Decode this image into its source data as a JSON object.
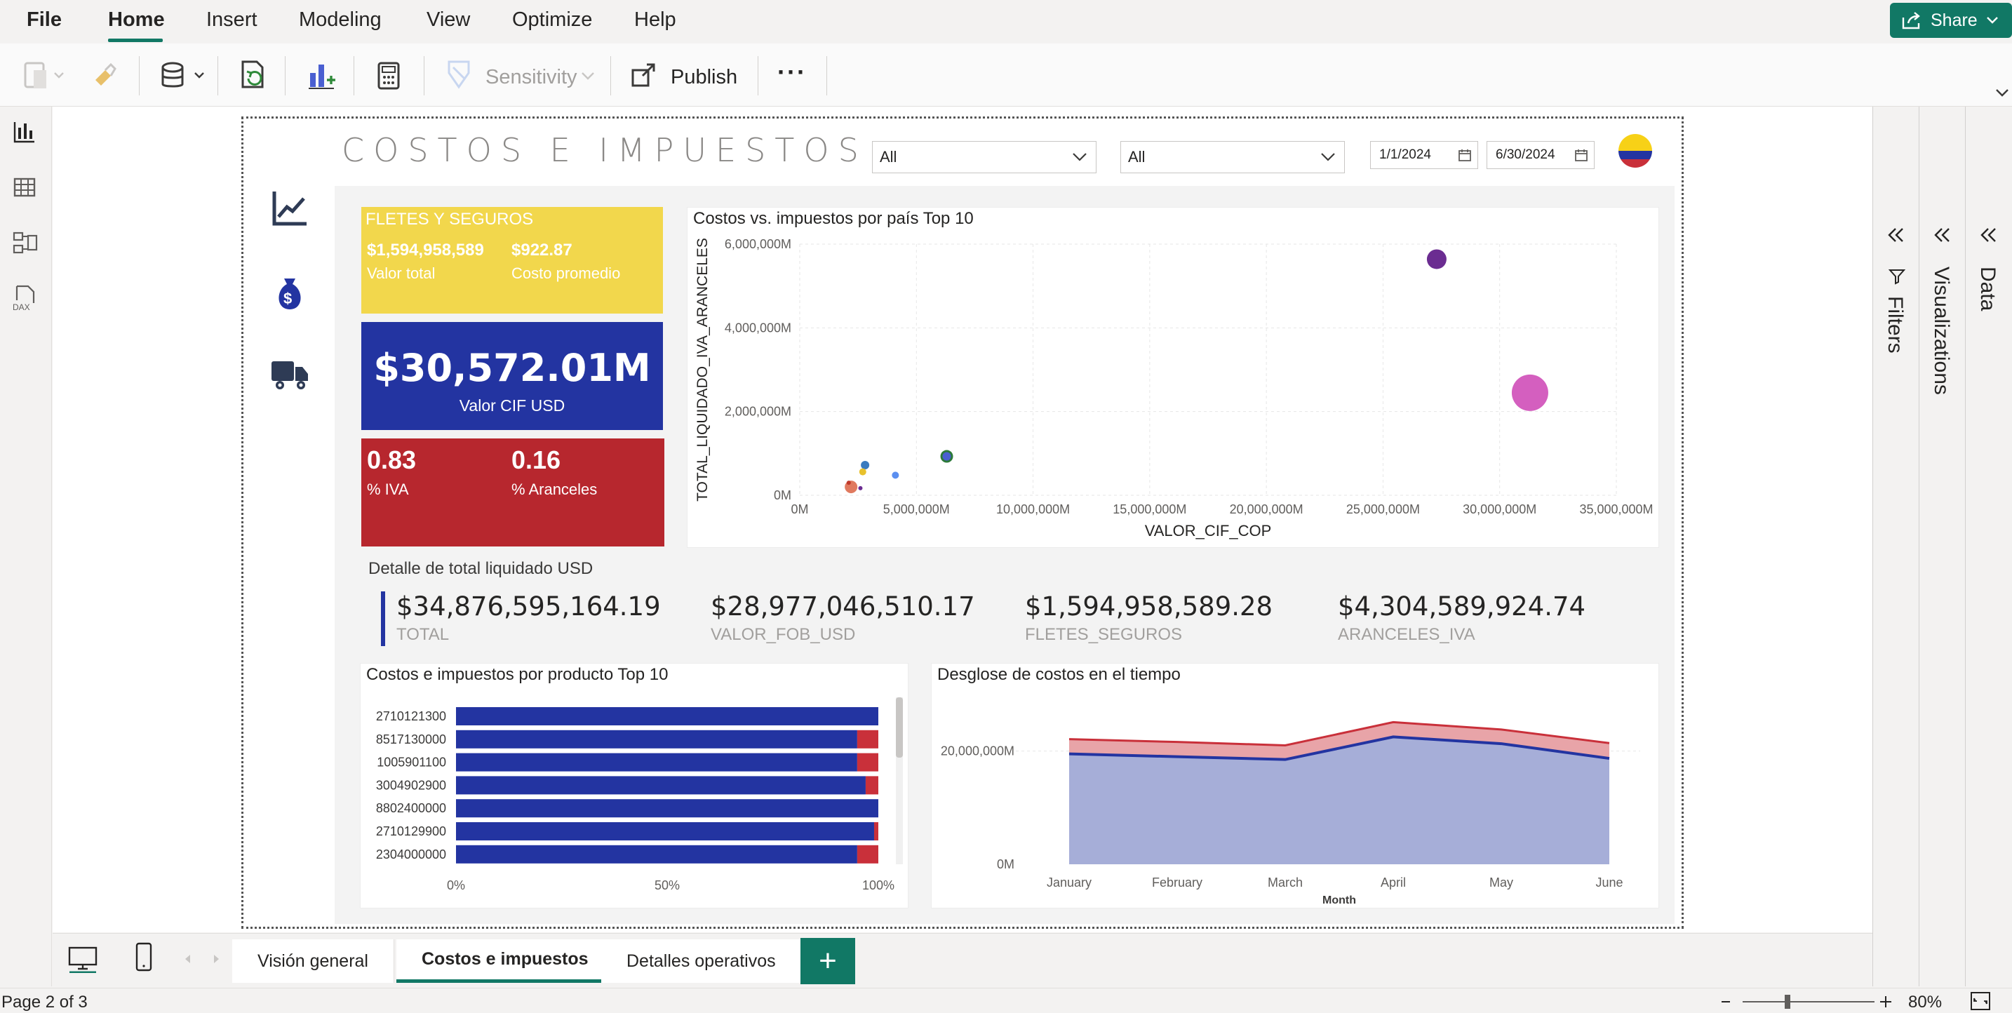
{
  "menu": {
    "file": "File",
    "items": [
      "Home",
      "Insert",
      "Modeling",
      "View",
      "Optimize",
      "Help"
    ],
    "share": "Share"
  },
  "ribbon": {
    "sensitivity": "Sensitivity",
    "publish": "Publish",
    "more": "···"
  },
  "report": {
    "title": "COSTOS E IMPUESTOS",
    "slicer1": "All",
    "slicer2": "All",
    "date_start": "1/1/2024",
    "date_end": "6/30/2024",
    "cards": {
      "fletes_title": "FLETES Y SEGUROS",
      "fletes_total": "$1,594,958,589",
      "fletes_total_label": "Valor total",
      "fletes_avg": "$922.87",
      "fletes_avg_label": "Costo promedio",
      "cif_value": "$30,572.01M",
      "cif_label": "Valor CIF USD",
      "iva_value": "0.83",
      "iva_label": "% IVA",
      "aranceles_value": "0.16",
      "aranceles_label": "% Aranceles"
    },
    "kpi": {
      "title": "Detalle de total liquidado USD",
      "items": [
        {
          "value": "$34,876,595,164.19",
          "label": "TOTAL"
        },
        {
          "value": "$28,977,046,510.17",
          "label": "VALOR_FOB_USD"
        },
        {
          "value": "$1,594,958,589.28",
          "label": "FLETES_SEGUROS"
        },
        {
          "value": "$4,304,589,924.74",
          "label": "ARANCELES_IVA"
        }
      ]
    }
  },
  "chart_data": [
    {
      "type": "scatter",
      "title": "Costos vs. impuestos por país Top 10",
      "xlabel": "VALOR_CIF_COP",
      "ylabel": "TOTAL_LIQUIDADO_IVA_ARANCELES",
      "xlim": [
        0,
        35000000
      ],
      "ylim": [
        0,
        6000000
      ],
      "x_ticks": [
        "0M",
        "5,000,000M",
        "10,000,000M",
        "15,000,000M",
        "20,000,000M",
        "25,000,000M",
        "30,000,000M",
        "35,000,000M"
      ],
      "y_ticks": [
        "0M",
        "2,000,000M",
        "4,000,000M",
        "6,000,000M"
      ],
      "points": [
        {
          "x": 27300000,
          "y": 5640000,
          "size": 14,
          "color": "#6b2c91"
        },
        {
          "x": 31300000,
          "y": 2450000,
          "size": 26,
          "color": "#d45fbf"
        },
        {
          "x": 6300000,
          "y": 930000,
          "size": 9,
          "color": "#2d7a3a"
        },
        {
          "x": 6300000,
          "y": 930000,
          "size": 6,
          "color": "#4a5fd1"
        },
        {
          "x": 2200000,
          "y": 200000,
          "size": 9,
          "color": "#e07a5f"
        },
        {
          "x": 2800000,
          "y": 720000,
          "size": 6,
          "color": "#3a7bbf"
        },
        {
          "x": 2700000,
          "y": 560000,
          "size": 5,
          "color": "#e8c12c"
        },
        {
          "x": 4100000,
          "y": 480000,
          "size": 5,
          "color": "#5b8ff0"
        },
        {
          "x": 2600000,
          "y": 170000,
          "size": 3,
          "color": "#6b2c91"
        },
        {
          "x": 2100000,
          "y": 300000,
          "size": 3,
          "color": "#c0392b"
        }
      ]
    },
    {
      "type": "bar",
      "title": "Costos e impuestos por producto Top 10",
      "categories": [
        "2710121300",
        "8517130000",
        "1005901100",
        "3004902900",
        "8802400000",
        "2710129900",
        "2304000000"
      ],
      "series": [
        {
          "values": [
            100,
            95,
            95,
            97,
            100,
            99,
            95
          ],
          "color": "#2334a1"
        },
        {
          "values": [
            0,
            5,
            5,
            3,
            0,
            1,
            5
          ],
          "color": "#c9303a"
        }
      ],
      "x_ticks": [
        "0%",
        "50%",
        "100%"
      ],
      "xlim": [
        0,
        100
      ]
    },
    {
      "type": "area",
      "title": "Desglose de costos en el tiempo",
      "xlabel": "Month",
      "categories": [
        "January",
        "February",
        "March",
        "April",
        "May",
        "June"
      ],
      "y_ticks": [
        "0M",
        "20,000,000M"
      ],
      "ylim": [
        0,
        28000000
      ],
      "series": [
        {
          "values": [
            19500000,
            19000000,
            18500000,
            22500000,
            21300000,
            18700000
          ],
          "color": "#2334a1"
        },
        {
          "values": [
            22100000,
            21600000,
            21000000,
            25100000,
            23800000,
            21400000
          ],
          "color": "#c9303a"
        }
      ]
    }
  ],
  "panes": {
    "filters": "Filters",
    "visualizations": "Visualizations",
    "data": "Data"
  },
  "tabs": [
    "Visión general",
    "Costos e impuestos",
    "Detalles operativos"
  ],
  "add_tab": "+",
  "status": {
    "page": "Page 2 of 3",
    "zoom": "80%"
  }
}
